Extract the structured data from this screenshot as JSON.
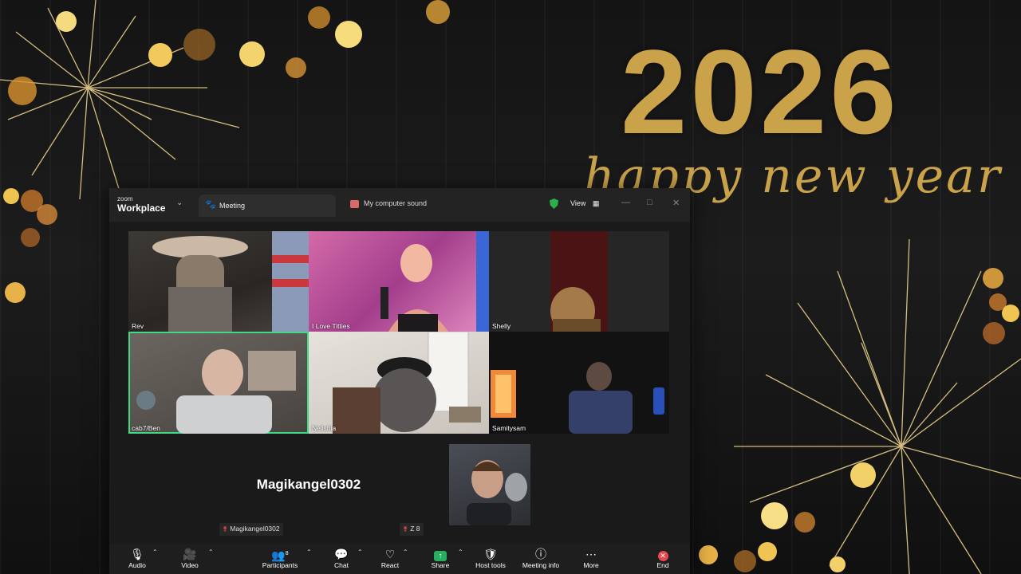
{
  "background": {
    "headline_year": "2026",
    "headline_greeting": "happy new year",
    "accent_color": "#c9a24a"
  },
  "window": {
    "brand_small": "zoom",
    "brand_large": "Workplace",
    "tabs": [
      {
        "label": "Meeting",
        "icon": "paw-icon"
      },
      {
        "label": "My computer sound",
        "icon": "speaker-app-icon"
      }
    ],
    "view_label": "View",
    "security_color": "#2dae4a"
  },
  "participants": [
    {
      "name": "Rev"
    },
    {
      "name": "I Love Titties"
    },
    {
      "name": "Shelly"
    },
    {
      "name": "cab7/Ben",
      "active_speaker": true
    },
    {
      "name": "Nelishia"
    },
    {
      "name": "Samitysam"
    }
  ],
  "no_video": {
    "big_name": "Magikangel0302",
    "chip_name": "Magikangel0302"
  },
  "video_thumb": {
    "chip_name": "Z 8"
  },
  "toolbar": {
    "audio": "Audio",
    "video": "Video",
    "participants": "Participants",
    "participants_count": "8",
    "chat": "Chat",
    "react": "React",
    "share": "Share",
    "host_tools": "Host tools",
    "meeting_info": "Meeting info",
    "more": "More",
    "end": "End",
    "end_color": "#e5484d",
    "share_color": "#27ae60",
    "active_speaker_color": "#3ddc84"
  }
}
